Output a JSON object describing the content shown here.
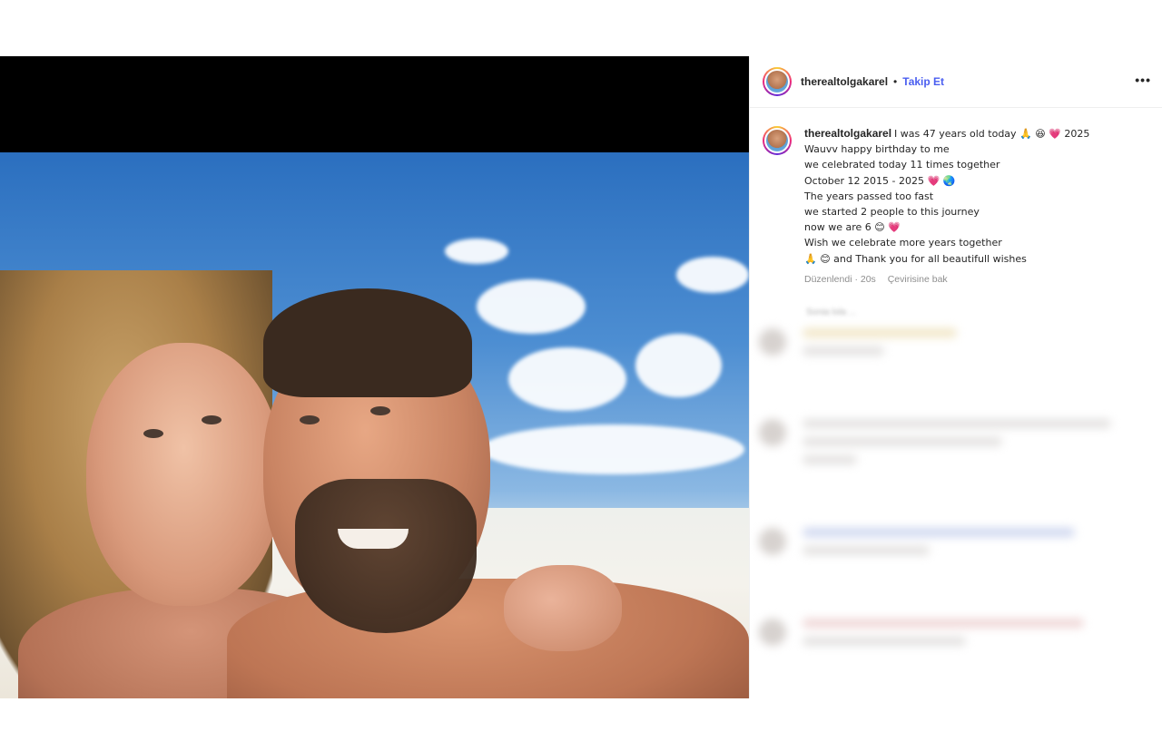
{
  "header": {
    "username": "therealtolgakarel",
    "separator": "•",
    "follow_label": "Takip Et",
    "more_label": "•••"
  },
  "caption": {
    "username": "therealtolgakarel",
    "lines": [
      "I was 47 years old today 🙏 😆 💗 2025",
      "Wauvv happy birthday to me",
      "we celebrated today 11 times together",
      "October 12 2015 - 2025 💗 🌏",
      "The years passed too fast",
      "we started 2 people to this journey",
      "now we are 6 😊 💗",
      "Wish we celebrate more years together",
      "🙏 😊  and Thank you for all beautifull wishes"
    ],
    "edited": "Düzenlendi · 20s",
    "translate": "Çevirisine bak"
  },
  "comments_hint": "Sonia lola ...",
  "icons": {
    "more": "more-options-icon",
    "avatar": "profile-avatar"
  },
  "colors": {
    "follow": "#4a5ef0",
    "meta": "#8e8e8e",
    "text": "#262626"
  }
}
